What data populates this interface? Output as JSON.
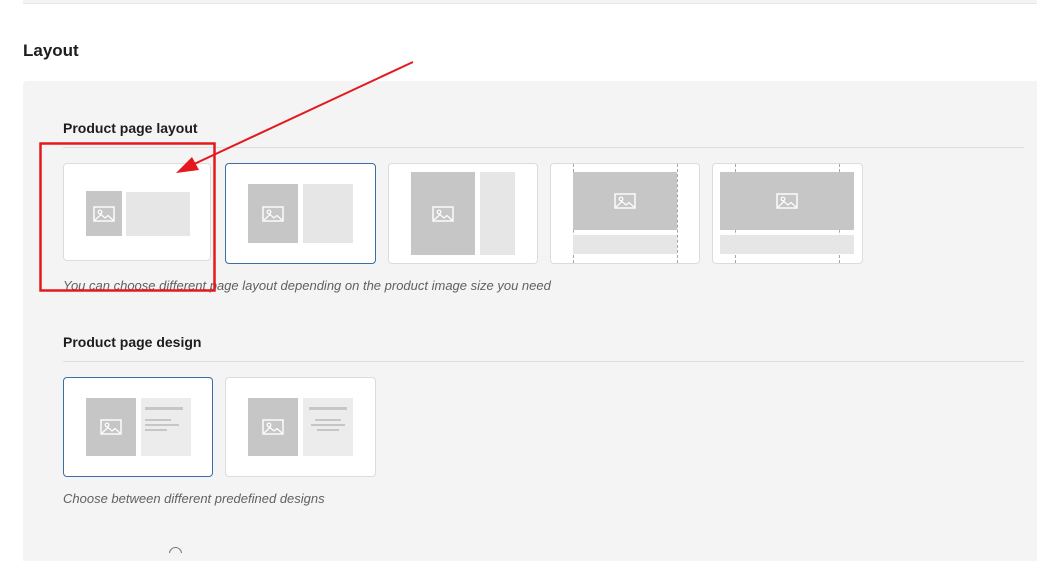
{
  "section": {
    "title": "Layout"
  },
  "product_page_layout": {
    "title": "Product page layout",
    "help_text": "You can choose different page layout depending on the product image size you need",
    "options": [
      {
        "icon": "image-icon",
        "selected": false
      },
      {
        "icon": "image-icon",
        "selected": true
      },
      {
        "icon": "image-icon",
        "selected": false
      },
      {
        "icon": "image-icon",
        "selected": false
      },
      {
        "icon": "image-icon",
        "selected": false
      }
    ]
  },
  "product_page_design": {
    "title": "Product page design",
    "help_text": "Choose between different predefined designs",
    "options": [
      {
        "icon": "image-icon",
        "selected": true
      },
      {
        "icon": "image-icon",
        "selected": false
      }
    ]
  },
  "annotation": {
    "color": "#e3191e"
  },
  "colors": {
    "selected_border": "#3a6ea5",
    "panel_bg": "#f4f4f4",
    "placeholder_dark": "#c6c6c6",
    "placeholder_light": "#e6e6e6"
  }
}
